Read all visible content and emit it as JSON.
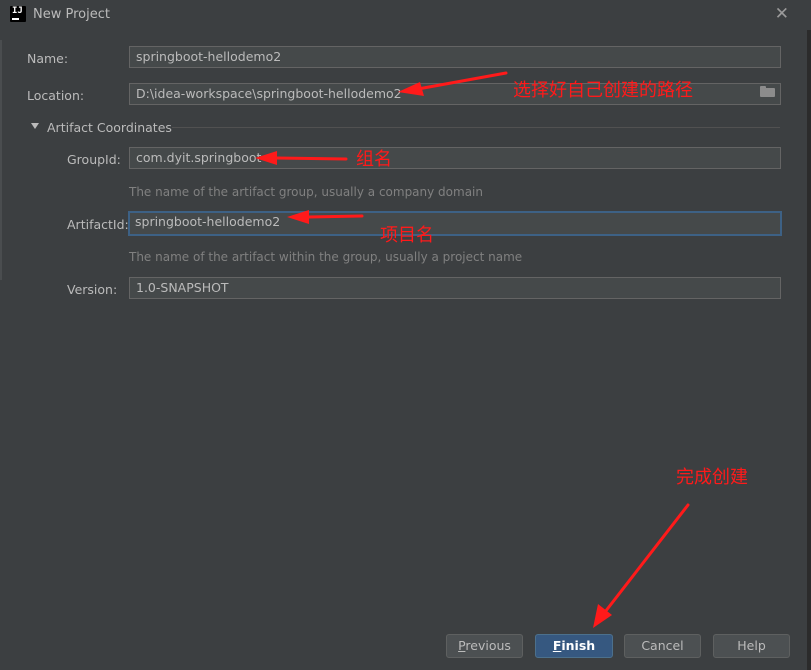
{
  "window": {
    "title": "New Project",
    "icon_text": "IJ"
  },
  "form": {
    "name": {
      "label": "Name:",
      "value": "springboot-hellodemo2"
    },
    "location": {
      "label": "Location:",
      "value": "D:\\idea-workspace\\springboot-hellodemo2"
    },
    "section": {
      "title": "Artifact Coordinates",
      "expanded": true
    },
    "group_id": {
      "label": "GroupId:",
      "value": "com.dyit.springboot",
      "hint": "The name of the artifact group, usually a company domain"
    },
    "artifact_id": {
      "label": "ArtifactId:",
      "value": "springboot-hellodemo2",
      "hint": "The name of the artifact within the group, usually a project name"
    },
    "version": {
      "label": "Version:",
      "value": "1.0-SNAPSHOT"
    }
  },
  "buttons": {
    "previous": {
      "first": "P",
      "rest": "revious"
    },
    "finish": {
      "first": "F",
      "rest": "inish"
    },
    "cancel": "Cancel",
    "help": "Help"
  },
  "annotations": {
    "location": "选择好自己创建的路径",
    "group_id": "组名",
    "artifact_id": "项目名",
    "finish": "完成创建",
    "color": "#ff1a1a"
  },
  "colors": {
    "background": "#3c3f41",
    "primary_button": "#365880",
    "focus_border": "#3d6185"
  }
}
